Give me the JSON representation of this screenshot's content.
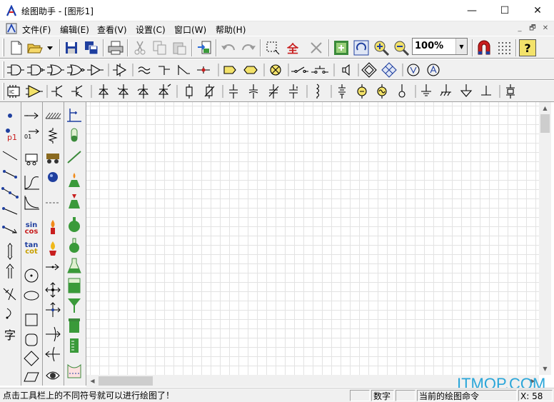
{
  "window": {
    "title": "绘图助手 - [图形1]",
    "controls": {
      "minimize": "—",
      "maximize": "☐",
      "close": "✕"
    }
  },
  "menubar": {
    "items": [
      {
        "label": "文件(F)"
      },
      {
        "label": "编辑(E)"
      },
      {
        "label": "查看(V)"
      },
      {
        "label": "设置(C)"
      },
      {
        "label": "窗口(W)"
      },
      {
        "label": "帮助(H)"
      }
    ],
    "mdi_controls": {
      "minimize": "_",
      "restore": "🗗",
      "close": "✕"
    }
  },
  "toolbar1": {
    "zoom_value": "100%",
    "buttons": [
      "new-icon",
      "open-icon",
      "save-icon",
      "save-all-icon",
      "print-icon",
      "cut-icon",
      "copy-icon",
      "paste-icon",
      "import-icon",
      "undo-icon",
      "redo-icon",
      "select-icon",
      "select-all-icon",
      "delete-icon",
      "fit-icon",
      "refresh-icon",
      "zoom-in-icon",
      "zoom-out-icon",
      "magnet-icon",
      "grid-icon",
      "help-icon"
    ],
    "select_all_glyph": "全",
    "help_glyph": "?"
  },
  "left_palette": {
    "p1_label": "p1",
    "sin_label": "sin",
    "cos_label": "cos",
    "tan_label": "tan",
    "cot_label": "cot",
    "text_tool_label": "字",
    "ot_label": "01"
  },
  "statusbar": {
    "hint": "点击工具栏上的不同符号就可以进行绘图了！",
    "num_lock": "数字",
    "current_command": "当前的绘图命令",
    "coord": "X: 58"
  },
  "watermark": "ITMOP.COM",
  "colors": {
    "accent_blue": "#2aa6d9",
    "canvas_grid": "#e3e3e3",
    "chrome": "#f0f0f0"
  }
}
